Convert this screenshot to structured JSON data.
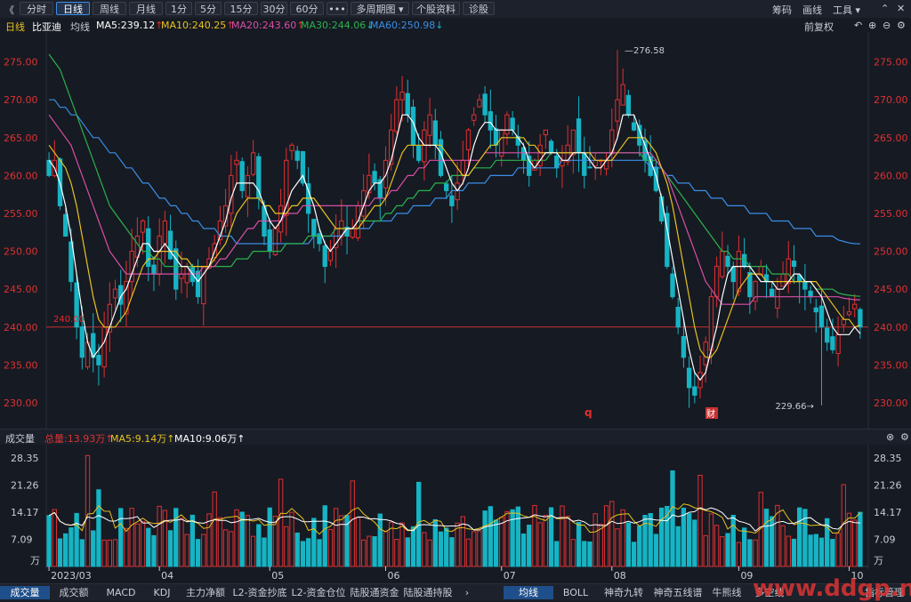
{
  "toolbar": {
    "back_label": "《",
    "tabs": [
      "分时",
      "日线",
      "周线",
      "月线",
      "1分",
      "5分",
      "15分",
      "30分",
      "60分",
      "•••",
      "多周期图 ▾",
      "个股资料",
      "诊股"
    ],
    "active_index": 1,
    "right_items": [
      "筹码",
      "画线",
      "工具 ▾"
    ]
  },
  "indicator_bar": {
    "period": "日线",
    "stock_name": "比亚迪",
    "avg_label": "均线",
    "ma5": "MA5:239.12",
    "ma10": "MA10:240.25",
    "ma20": "MA20:243.60",
    "ma30": "MA30:244.06",
    "ma60": "MA60:250.98",
    "fq_label": "前复权"
  },
  "volume_bar": {
    "title": "成交量",
    "total": "总量:13.93万",
    "ma5": "MA5:9.14万",
    "ma10": "MA10:9.06万"
  },
  "bottom_tabs_left": [
    "成交量",
    "成交额",
    "MACD",
    "KDJ",
    "主力净额",
    "L2-资金抄底",
    "L2-资金仓位",
    "陆股通资金",
    "陆股通持股"
  ],
  "bottom_tabs_right": [
    "均线",
    "BOLL",
    "神奇九转",
    "神奇五线谱",
    "牛熊线",
    "多空线",
    "指标管理"
  ],
  "watermark": "www.ddgp.net",
  "annotations": {
    "high_label": "276.58",
    "low_label": "229.66→",
    "ref_line_label": "240.00",
    "event_q": "q",
    "event_cai": "财"
  },
  "colors": {
    "up": "#e03030",
    "down": "#16b4c4",
    "ma5": "#ffffff",
    "ma10": "#e8c21e",
    "ma20": "#d84fa6",
    "ma30": "#2bb24c",
    "ma60": "#3a8ee6"
  },
  "chart_data": {
    "type": "candlestick",
    "price_axis": {
      "ticks": [
        230,
        235,
        240,
        245,
        250,
        255,
        260,
        265,
        270,
        275
      ],
      "range": [
        228,
        278
      ]
    },
    "volume_axis": {
      "ticks": [
        "28.35",
        "21.26",
        "14.17",
        "7.09"
      ],
      "unit": "万",
      "range": [
        0,
        30
      ]
    },
    "x_axis_labels": [
      {
        "label": "2023/03",
        "index": 0
      },
      {
        "label": "04",
        "index": 20
      },
      {
        "label": "05",
        "index": 40
      },
      {
        "label": "06",
        "index": 61
      },
      {
        "label": "07",
        "index": 82
      },
      {
        "label": "08",
        "index": 102
      },
      {
        "label": "09",
        "index": 125
      },
      {
        "label": "10",
        "index": 145
      }
    ],
    "ma_labels": [
      "MA5",
      "MA10",
      "MA20",
      "MA30",
      "MA60"
    ],
    "candle_count": 148,
    "closes": [
      260,
      262,
      256,
      252,
      246,
      240,
      236,
      238,
      236,
      235,
      240,
      243,
      245,
      243,
      246,
      250,
      252,
      254,
      248,
      247,
      252,
      254,
      249,
      245,
      247,
      248,
      246,
      244,
      248,
      249,
      251,
      254,
      256,
      260,
      262,
      258,
      260,
      263,
      257,
      252,
      250,
      253,
      256,
      262,
      264,
      262,
      259,
      255,
      252,
      251,
      248,
      250,
      253,
      254,
      252,
      253,
      256,
      258,
      260,
      259,
      257,
      262,
      266,
      270,
      271,
      268,
      264,
      262,
      266,
      268,
      264,
      260,
      258,
      256,
      259,
      262,
      266,
      268,
      270,
      268,
      266,
      264,
      266,
      268,
      266,
      264,
      262,
      260,
      262,
      264,
      266,
      263,
      261,
      262,
      264,
      266,
      263,
      260,
      261,
      262,
      262,
      262,
      266,
      270,
      272,
      268,
      266,
      264,
      262,
      260,
      258,
      254,
      248,
      244,
      240,
      236,
      232,
      231,
      234,
      238,
      244,
      248,
      250,
      248,
      246,
      250,
      248,
      244,
      246,
      248,
      246,
      244,
      245,
      247,
      249,
      248,
      246,
      245,
      244,
      242,
      240,
      238,
      237,
      239,
      241,
      242,
      243,
      240
    ],
    "ma5": [
      262,
      261,
      259,
      256,
      252,
      247,
      242,
      238,
      236,
      237,
      238,
      240,
      242,
      244,
      245,
      247,
      249,
      251,
      251,
      250,
      250,
      251,
      250,
      249,
      248,
      248,
      247,
      246,
      247,
      248,
      250,
      252,
      254,
      257,
      259,
      259,
      259,
      259,
      258,
      256,
      254,
      253,
      254,
      256,
      258,
      259,
      260,
      258,
      256,
      253,
      251,
      250,
      251,
      252,
      253,
      253,
      254,
      256,
      258,
      259,
      259,
      260,
      262,
      265,
      268,
      268,
      267,
      265,
      264,
      264,
      264,
      263,
      261,
      259,
      258,
      259,
      261,
      264,
      266,
      267,
      267,
      266,
      266,
      266,
      266,
      265,
      264,
      262,
      261,
      262,
      263,
      263,
      263,
      262,
      262,
      263,
      263,
      263,
      262,
      261,
      261,
      262,
      263,
      265,
      268,
      268,
      268,
      266,
      264,
      262,
      260,
      257,
      253,
      249,
      245,
      241,
      237,
      234,
      233,
      234,
      237,
      240,
      244,
      247,
      248,
      248,
      248,
      248,
      247,
      246,
      246,
      246,
      245,
      245,
      246,
      247,
      247,
      246,
      246,
      245,
      244,
      242,
      240,
      239,
      239,
      239,
      240,
      239.12
    ],
    "ma10": [
      264,
      263,
      262,
      261,
      259,
      256,
      252,
      248,
      244,
      241,
      240,
      240,
      240,
      241,
      242,
      244,
      246,
      248,
      249,
      249,
      250,
      250,
      250,
      250,
      249,
      249,
      248,
      248,
      248,
      248,
      249,
      250,
      251,
      253,
      255,
      256,
      257,
      257,
      257,
      256,
      256,
      255,
      255,
      255,
      256,
      256,
      257,
      257,
      257,
      256,
      255,
      254,
      253,
      253,
      253,
      253,
      253,
      254,
      255,
      256,
      256,
      257,
      259,
      261,
      263,
      264,
      264,
      264,
      264,
      264,
      264,
      264,
      263,
      262,
      261,
      260,
      260,
      261,
      262,
      263,
      264,
      264,
      265,
      265,
      265,
      265,
      265,
      264,
      264,
      263,
      263,
      263,
      263,
      263,
      263,
      263,
      263,
      263,
      263,
      262,
      262,
      262,
      262,
      263,
      264,
      265,
      265,
      265,
      265,
      264,
      263,
      261,
      259,
      256,
      252,
      248,
      244,
      240,
      237,
      236,
      236,
      237,
      239,
      241,
      243,
      245,
      246,
      247,
      247,
      247,
      246,
      246,
      246,
      246,
      246,
      246,
      246,
      246,
      246,
      246,
      245,
      244,
      243,
      242,
      241,
      241,
      240,
      240.25
    ],
    "ma20": [
      268,
      267,
      266,
      265,
      264,
      262,
      260,
      258,
      256,
      254,
      252,
      250,
      249,
      248,
      247,
      247,
      247,
      247,
      247,
      247,
      247,
      247,
      247,
      247,
      247,
      247,
      247,
      247,
      248,
      248,
      248,
      249,
      249,
      250,
      251,
      252,
      253,
      253,
      254,
      254,
      254,
      254,
      254,
      255,
      255,
      255,
      256,
      256,
      256,
      256,
      256,
      256,
      256,
      256,
      256,
      256,
      256,
      256,
      256,
      257,
      257,
      257,
      258,
      258,
      259,
      260,
      260,
      261,
      261,
      262,
      262,
      262,
      262,
      262,
      262,
      262,
      262,
      262,
      262,
      263,
      263,
      263,
      263,
      263,
      263,
      263,
      263,
      263,
      263,
      263,
      263,
      263,
      263,
      263,
      263,
      263,
      263,
      263,
      263,
      263,
      263,
      263,
      263,
      263,
      263,
      263,
      263,
      263,
      263,
      263,
      262,
      261,
      260,
      258,
      256,
      254,
      252,
      250,
      248,
      246,
      245,
      244,
      243,
      243,
      243,
      243,
      243,
      243,
      244,
      244,
      244,
      244,
      244,
      244,
      244,
      244,
      244,
      244,
      244,
      244,
      244,
      244,
      244,
      244,
      243.8,
      243.7,
      243.6,
      243.6
    ],
    "ma30": [
      276,
      275,
      274,
      272,
      270,
      268,
      266,
      264,
      262,
      260,
      258,
      256,
      255,
      254,
      253,
      252,
      251,
      250,
      250,
      249,
      249,
      248,
      248,
      248,
      248,
      248,
      248,
      248,
      248,
      248,
      248,
      248,
      248,
      248,
      249,
      249,
      249,
      250,
      250,
      250,
      250,
      250,
      250,
      251,
      251,
      251,
      251,
      252,
      252,
      252,
      252,
      252,
      253,
      253,
      253,
      253,
      254,
      254,
      254,
      254,
      254,
      255,
      255,
      256,
      256,
      257,
      257,
      258,
      258,
      258,
      259,
      259,
      259,
      260,
      260,
      260,
      260,
      261,
      261,
      261,
      261,
      262,
      262,
      262,
      262,
      262,
      262,
      262,
      262,
      262,
      262,
      263,
      263,
      263,
      263,
      263,
      263,
      263,
      263,
      263,
      263,
      263,
      263,
      263,
      263,
      263,
      263,
      263,
      262,
      262,
      262,
      261,
      260,
      259,
      258,
      257,
      256,
      255,
      254,
      253,
      252,
      251,
      250,
      250,
      249,
      249,
      249,
      248,
      248,
      248,
      248,
      247,
      247,
      247,
      247,
      246,
      246,
      246,
      246,
      245,
      245,
      245,
      245,
      244.5,
      244.3,
      244.2,
      244.1,
      244.06
    ],
    "ma60": [
      270,
      270,
      269,
      269,
      268,
      268,
      267,
      266,
      265,
      265,
      264,
      263,
      263,
      262,
      261,
      261,
      260,
      259,
      259,
      258,
      257,
      257,
      256,
      256,
      255,
      255,
      254,
      254,
      253,
      253,
      253,
      252,
      252,
      252,
      251,
      251,
      251,
      251,
      251,
      251,
      251,
      251,
      251,
      251,
      251,
      251,
      251,
      251,
      252,
      252,
      252,
      252,
      252,
      252,
      253,
      253,
      253,
      253,
      253,
      254,
      254,
      254,
      254,
      255,
      255,
      255,
      256,
      256,
      256,
      256,
      257,
      257,
      257,
      258,
      258,
      258,
      259,
      259,
      259,
      259,
      260,
      260,
      260,
      260,
      260,
      261,
      261,
      261,
      261,
      261,
      261,
      261,
      261,
      262,
      262,
      262,
      262,
      262,
      262,
      262,
      262,
      262,
      262,
      262,
      262,
      262,
      262,
      262,
      262,
      261,
      261,
      261,
      260,
      260,
      259,
      259,
      259,
      258,
      258,
      258,
      257,
      257,
      257,
      256,
      256,
      256,
      256,
      255,
      255,
      255,
      255,
      254,
      254,
      254,
      254,
      253,
      253,
      253,
      253,
      252,
      252,
      252,
      252,
      251.5,
      251.3,
      251.1,
      251.0,
      250.98
    ],
    "volume_ma5_level": "MA5:9.14万",
    "volume_ma10_level": "MA10:9.06万"
  }
}
